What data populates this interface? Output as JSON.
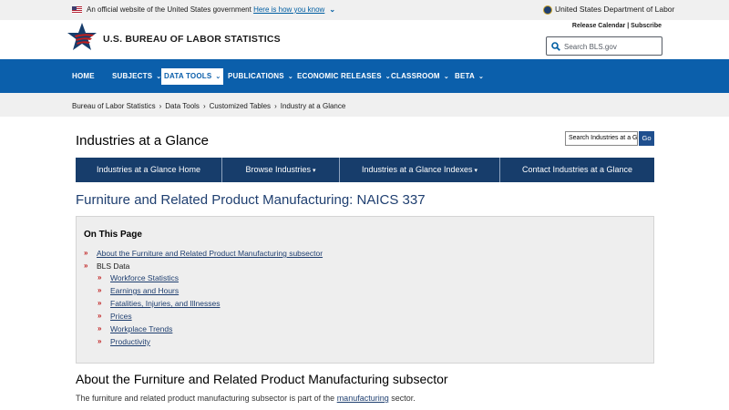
{
  "gov_banner": {
    "official_text": "An official website of the United States government",
    "how_link": "Here is how you know",
    "dept": "United States Department of Labor"
  },
  "header": {
    "site_title": "U.S. BUREAU OF LABOR STATISTICS",
    "release_calendar": "Release Calendar",
    "divider": "|",
    "subscribe": "Subscribe",
    "search_placeholder": "Search BLS.gov"
  },
  "main_nav": {
    "items": [
      {
        "label": "HOME"
      },
      {
        "label": "SUBJECTS"
      },
      {
        "label": "DATA TOOLS"
      },
      {
        "label": "PUBLICATIONS"
      },
      {
        "label": "ECONOMIC RELEASES"
      },
      {
        "label": "CLASSROOM"
      },
      {
        "label": "BETA"
      }
    ],
    "active": "DATA TOOLS"
  },
  "breadcrumb": {
    "items": [
      "Bureau of Labor Statistics",
      "Data Tools",
      "Customized Tables",
      "Industry at a Glance"
    ],
    "separator": "›"
  },
  "page": {
    "heading": "Industries at a Glance",
    "search_value": "Search Industries at a Glance",
    "go_label": "Go"
  },
  "sub_nav": {
    "items": [
      {
        "label": "Industries at a Glance Home",
        "dropdown": false
      },
      {
        "label": "Browse Industries",
        "dropdown": true
      },
      {
        "label": "Industries at a Glance Indexes",
        "dropdown": true
      },
      {
        "label": "Contact Industries at a Glance",
        "dropdown": false
      }
    ],
    "dropdown_glyph": "▾"
  },
  "section_title": "Furniture and Related Product Manufacturing: NAICS 337",
  "on_this_page": {
    "title": "On This Page",
    "bullet": "»",
    "about_link": "About the Furniture and Related Product Manufacturing subsector",
    "bls_data_label": "BLS Data",
    "sub_links": [
      "Workforce Statistics",
      "Earnings and Hours",
      "Fatalities, Injuries, and Illnesses",
      "Prices",
      "Workplace Trends",
      "Productivity"
    ]
  },
  "about": {
    "heading": "About the Furniture and Related Product Manufacturing subsector",
    "text_before": "The furniture and related product manufacturing subsector is part of the",
    "link": "manufacturing",
    "text_after": "sector."
  },
  "colors": {
    "nav_blue": "#0b5fab",
    "subnav_navy": "#173d6b",
    "link_navy": "#1f3f70",
    "bullet_red": "#c01e1e",
    "crumb_gray": "#f0f0f0"
  }
}
